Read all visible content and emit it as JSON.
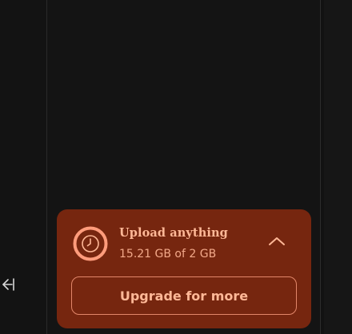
{
  "sidebar": {
    "collapse_icon": "collapse-left-icon"
  },
  "storage": {
    "icon": "clock-icon",
    "title": "Upload anything",
    "usage": "15.21 GB of 2 GB",
    "toggle_icon": "chevron-up-icon",
    "upgrade_label": "Upgrade for more"
  },
  "colors": {
    "background": "#141414",
    "card_background": "#76260f",
    "accent_text": "#ffb897",
    "accent_border": "#e2876a"
  }
}
